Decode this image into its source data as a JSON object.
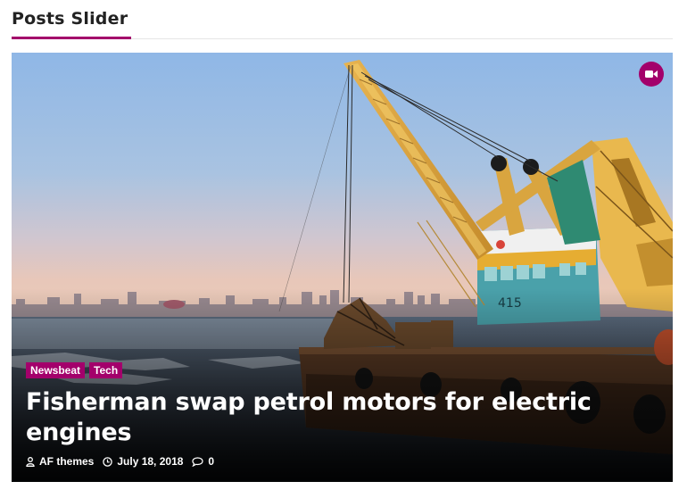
{
  "widget": {
    "title": "Posts Slider"
  },
  "slide": {
    "format_icon": "video-camera-icon",
    "categories": [
      {
        "label": "Newsbeat"
      },
      {
        "label": "Tech"
      }
    ],
    "title": "Fisherman swap petrol motors for electric engines",
    "meta": {
      "author": "AF themes",
      "date": "July 18, 2018",
      "comments": "0"
    },
    "crane_cab_number": "415"
  },
  "colors": {
    "accent": "#a3006b"
  }
}
